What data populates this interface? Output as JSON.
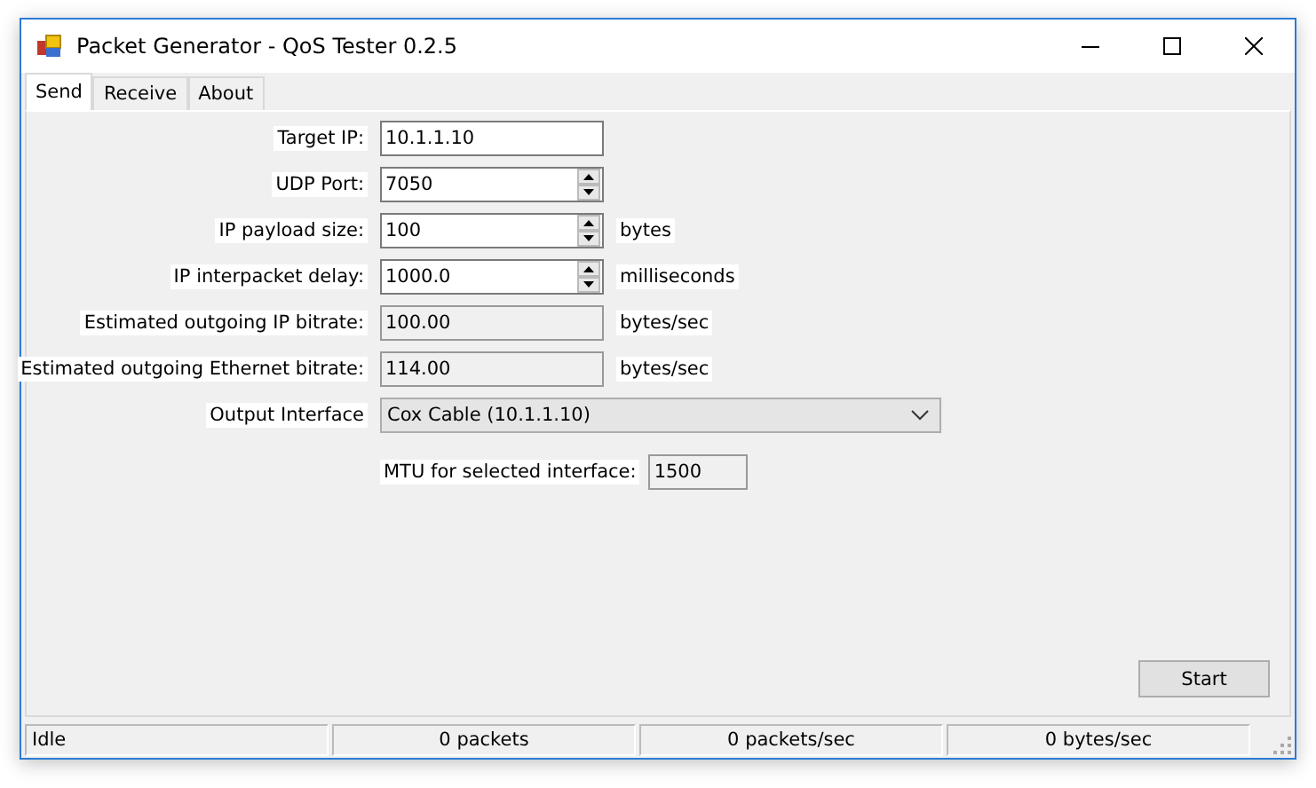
{
  "window": {
    "title": "Packet Generator - QoS Tester 0.2.5"
  },
  "tabs": [
    {
      "label": "Send",
      "selected": true
    },
    {
      "label": "Receive",
      "selected": false
    },
    {
      "label": "About",
      "selected": false
    }
  ],
  "fields": [
    {
      "label": "Target IP:",
      "kind": "text",
      "value": "10.1.1.10"
    },
    {
      "label": "UDP Port:",
      "kind": "spin",
      "value": "7050"
    },
    {
      "label": "IP payload size:",
      "kind": "spin",
      "value": "100",
      "unit": "bytes"
    },
    {
      "label": "IP interpacket delay:",
      "kind": "spin",
      "value": "1000.0",
      "unit": "milliseconds"
    },
    {
      "label": "Estimated outgoing IP bitrate:",
      "kind": "readonly",
      "value": "100.00",
      "unit": "bytes/sec"
    },
    {
      "label": "Estimated outgoing Ethernet bitrate:",
      "kind": "readonly",
      "value": "114.00",
      "unit": "bytes/sec"
    }
  ],
  "output_interface": {
    "label": "Output Interface",
    "value": "Cox Cable (10.1.1.10)"
  },
  "mtu": {
    "label": "MTU for selected interface:",
    "value": "1500"
  },
  "start_button": "Start",
  "status_bar": [
    "Idle",
    "0 packets",
    "0 packets/sec",
    "0 bytes/sec"
  ]
}
